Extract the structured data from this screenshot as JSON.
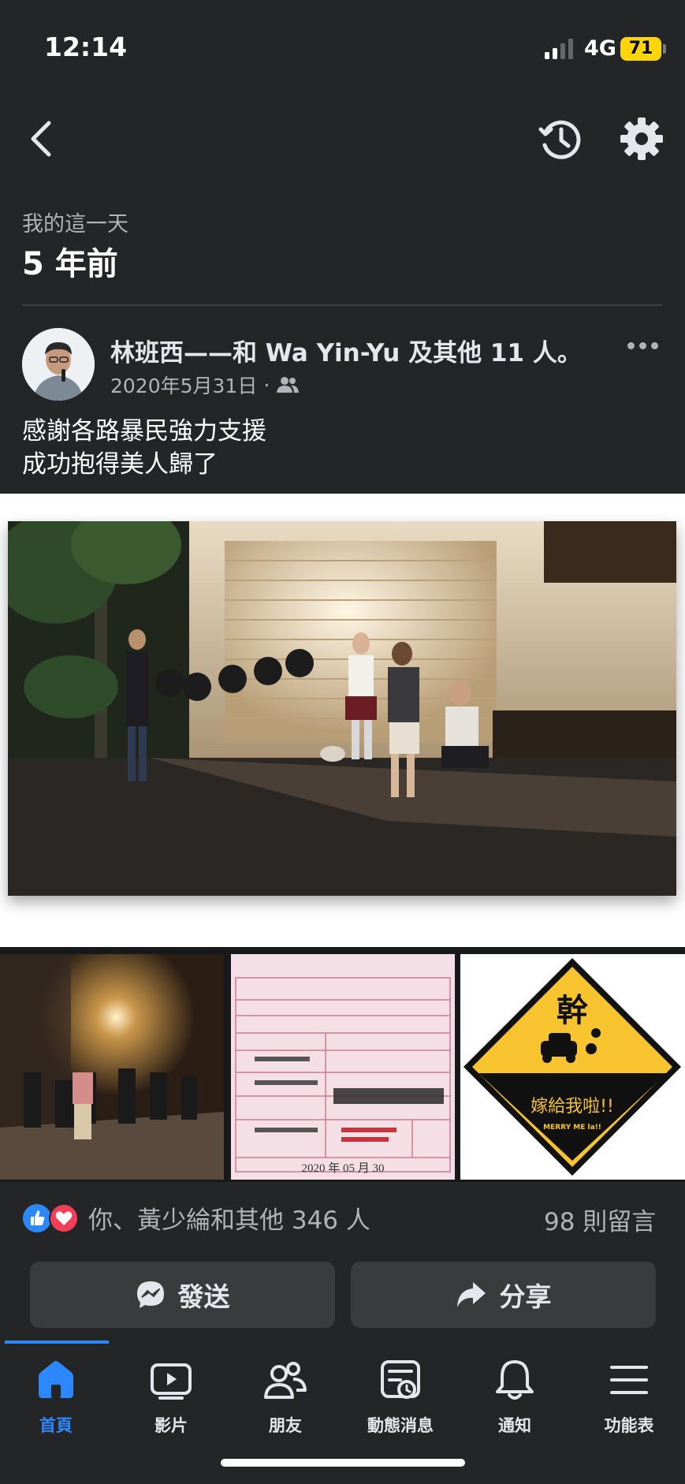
{
  "status_bar": {
    "time": "12:14",
    "network": "4G",
    "battery": "71"
  },
  "header": {
    "day_label": "我的這一天",
    "years_ago": "5 年前",
    "icons": [
      "back-icon",
      "history-icon",
      "gear-icon"
    ]
  },
  "post": {
    "author_line": "林班西——和 Wa Yin-Yu 及其他 11 人。",
    "date": "2020年5月31日",
    "text": "感謝各路暴民強力支援\n成功抱得美人歸了"
  },
  "thumbs": {
    "ticket_date": "2020  年  05  月  30",
    "sign_title": "幹",
    "sign_text": "嫁給我啦!!",
    "sign_sub": "MERRY ME la!!"
  },
  "engagement": {
    "reactions_text": "你、黃少綸和其他 346 人",
    "comments_text": "98 則留言",
    "reaction_icons": [
      "like-icon",
      "love-icon"
    ]
  },
  "actions": {
    "send_label": "發送",
    "share_label": "分享"
  },
  "nav": {
    "items": [
      {
        "label": "首頁",
        "icon": "home-icon",
        "active": true
      },
      {
        "label": "影片",
        "icon": "video-icon",
        "active": false
      },
      {
        "label": "朋友",
        "icon": "friends-icon",
        "active": false
      },
      {
        "label": "動態消息",
        "icon": "feed-icon",
        "active": false
      },
      {
        "label": "通知",
        "icon": "bell-icon",
        "active": false
      },
      {
        "label": "功能表",
        "icon": "menu-icon",
        "active": false
      }
    ]
  },
  "colors": {
    "background": "#242526",
    "accent": "#2d88ff",
    "battery": "#ffd60a"
  }
}
